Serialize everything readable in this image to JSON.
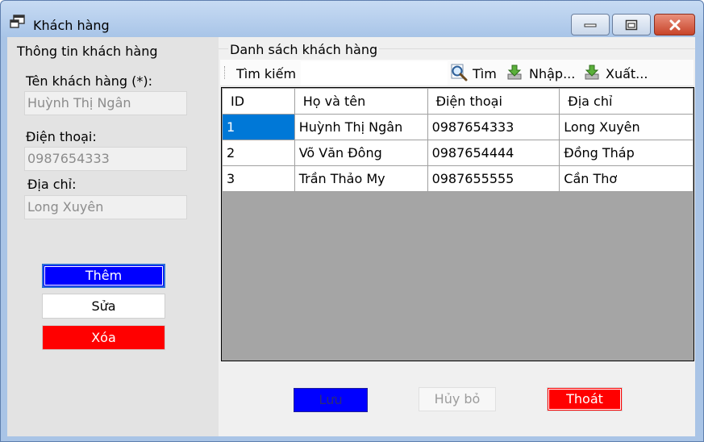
{
  "window": {
    "title": "Khách hàng",
    "minimize_icon": "minimize-icon",
    "maximize_icon": "maximize-icon",
    "close_icon": "close-icon"
  },
  "info_panel": {
    "title": "Thông tin khách hàng",
    "name_label": "Tên khách hàng (*):",
    "name_value": "Huỳnh Thị Ngân",
    "phone_label": "Điện thoại:",
    "phone_value": "0987654333",
    "address_label": "Địa chỉ:",
    "address_value": "Long Xuyên",
    "add_button": "Thêm",
    "edit_button": "Sửa",
    "delete_button": "Xóa"
  },
  "list_panel": {
    "title": "Danh sách khách hàng",
    "toolbar": {
      "search_label": "Tìm kiếm",
      "search_value": "",
      "find_button": "Tìm",
      "import_button": "Nhập...",
      "export_button": "Xuất..."
    },
    "table": {
      "columns": [
        "ID",
        "Họ và tên",
        "Điện thoại",
        "Địa chỉ"
      ],
      "rows": [
        [
          "1",
          "Huỳnh Thị Ngân",
          "0987654333",
          "Long Xuyên"
        ],
        [
          "2",
          "Võ Văn Đông",
          "0987654444",
          "Đồng Tháp"
        ],
        [
          "3",
          "Trần Thảo My",
          "0987655555",
          "Cần Thơ"
        ]
      ],
      "selected_row": 0
    }
  },
  "footer": {
    "save_button": "Lưu",
    "cancel_button": "Hủy bỏ",
    "exit_button": "Thoát"
  },
  "colors": {
    "add": "#0000ff",
    "delete": "#ff0000",
    "selection": "#0078d7",
    "grid_background": "#a5a5a5"
  }
}
